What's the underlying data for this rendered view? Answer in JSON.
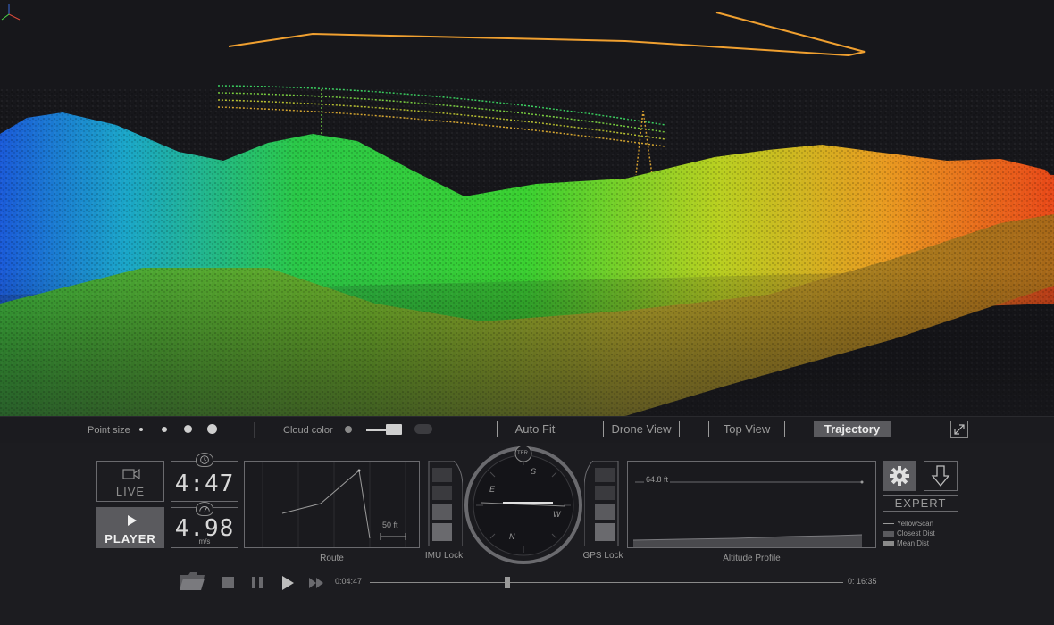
{
  "toolbar": {
    "point_size_label": "Point size",
    "cloud_color_label": "Cloud color",
    "views": [
      "Auto Fit",
      "Drone View",
      "Top View",
      "Trajectory"
    ],
    "active_view": "Trajectory"
  },
  "mode": {
    "live_label": "LIVE",
    "player_label": "PLAYER",
    "active": "PLAYER"
  },
  "readouts": {
    "elapsed": "4:47",
    "speed": "4.98",
    "speed_unit": "m/s"
  },
  "route": {
    "caption": "Route",
    "scale_label": "50 ft"
  },
  "compass": {
    "top_badge": "TER",
    "labels": [
      "S",
      "E",
      "W",
      "N"
    ]
  },
  "imu": {
    "caption": "IMU Lock"
  },
  "gps": {
    "caption": "GPS Lock"
  },
  "altitude": {
    "caption": "Altitude Profile",
    "value_label": "64.8 ft",
    "legend": [
      "YellowScan",
      "Closest Dist",
      "Mean Dist"
    ]
  },
  "actions": {
    "expert_label": "EXPERT"
  },
  "playback": {
    "current_time": "0:04:47",
    "total_time": "0: 16:35",
    "progress": 0.29
  },
  "icons": [
    "camera-icon",
    "clock-icon",
    "speedometer-icon",
    "gear-icon",
    "download-arrow-icon",
    "folder-icon",
    "stop-icon",
    "pause-icon",
    "play-icon",
    "fast-forward-icon",
    "expand-icon",
    "axes-icon"
  ],
  "colors": {
    "background": "#1c1c20",
    "trajectory": "#f0a030",
    "active_button": "#5a5a5e",
    "text": "#bdbdbd"
  }
}
